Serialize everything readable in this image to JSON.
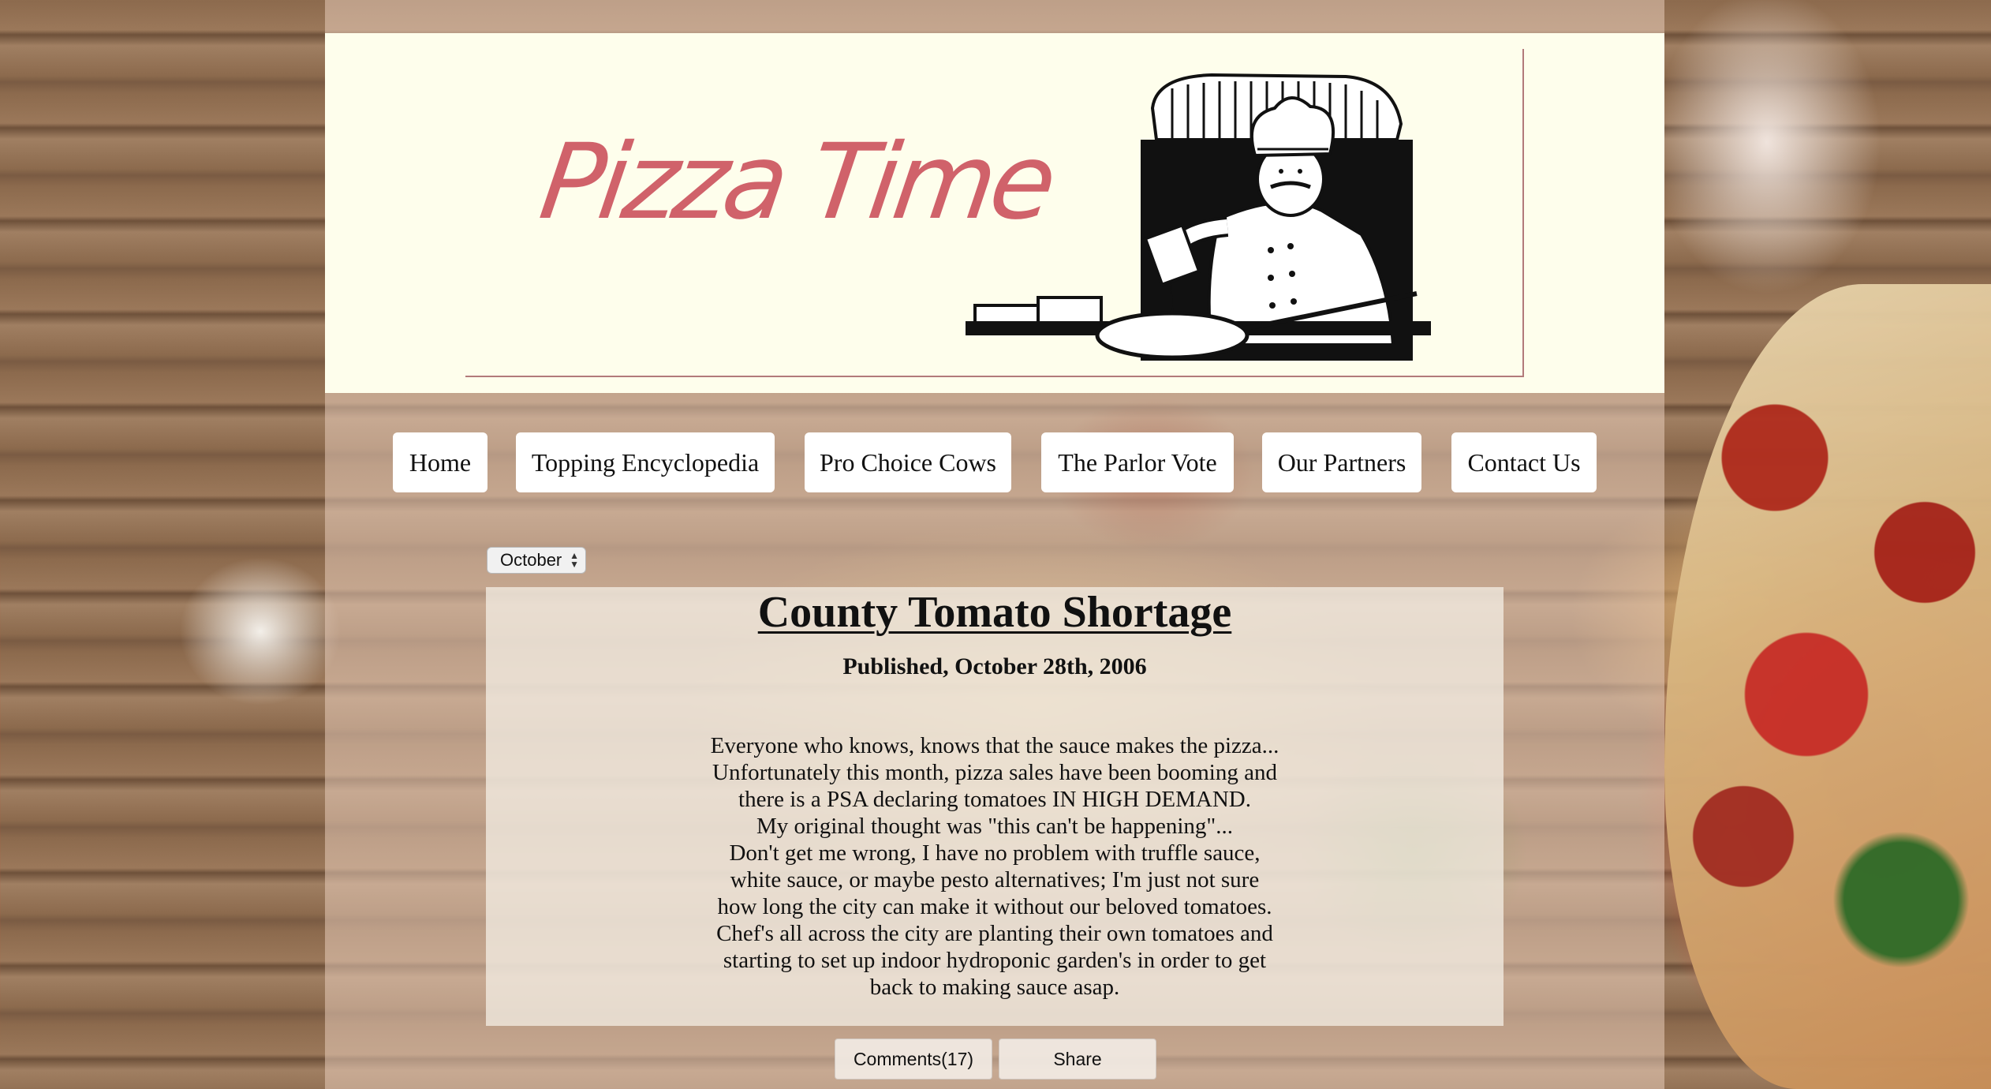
{
  "brand": {
    "logo_text": "Pizza Time",
    "logo_color": "#d0626a"
  },
  "nav": {
    "items": [
      {
        "label": "Home"
      },
      {
        "label": "Topping Encyclopedia"
      },
      {
        "label": "Pro Choice Cows"
      },
      {
        "label": "The Parlor Vote"
      },
      {
        "label": "Our Partners"
      },
      {
        "label": "Contact Us"
      }
    ]
  },
  "archive": {
    "selected_month": "October"
  },
  "article": {
    "title": "County Tomato Shortage",
    "published": "Published, October 28th, 2006",
    "body_lines": [
      "Everyone who knows, knows that the sauce makes the pizza...",
      "Unfortunately this month, pizza sales have been booming and",
      "there is a PSA declaring tomatoes IN HIGH DEMAND.",
      "My original thought was \"this can't be happening\"...",
      "Don't get me wrong, I have no problem with truffle sauce,",
      "white sauce, or maybe pesto alternatives; I'm just not sure",
      "how long the city can make it without our beloved tomatoes.",
      "Chef's all across the city are planting their own tomatoes and",
      "starting to set up indoor hydroponic garden's in order to get",
      "back to making sauce asap."
    ]
  },
  "actions": {
    "comments_label": "Comments(17)",
    "share_label": "Share"
  },
  "colors": {
    "header_bg": "#fefeec",
    "nav_button_bg": "#ffffff"
  },
  "icons": {
    "select_arrows": "updown-chevron-icon",
    "header_art": "chef-illustration"
  }
}
